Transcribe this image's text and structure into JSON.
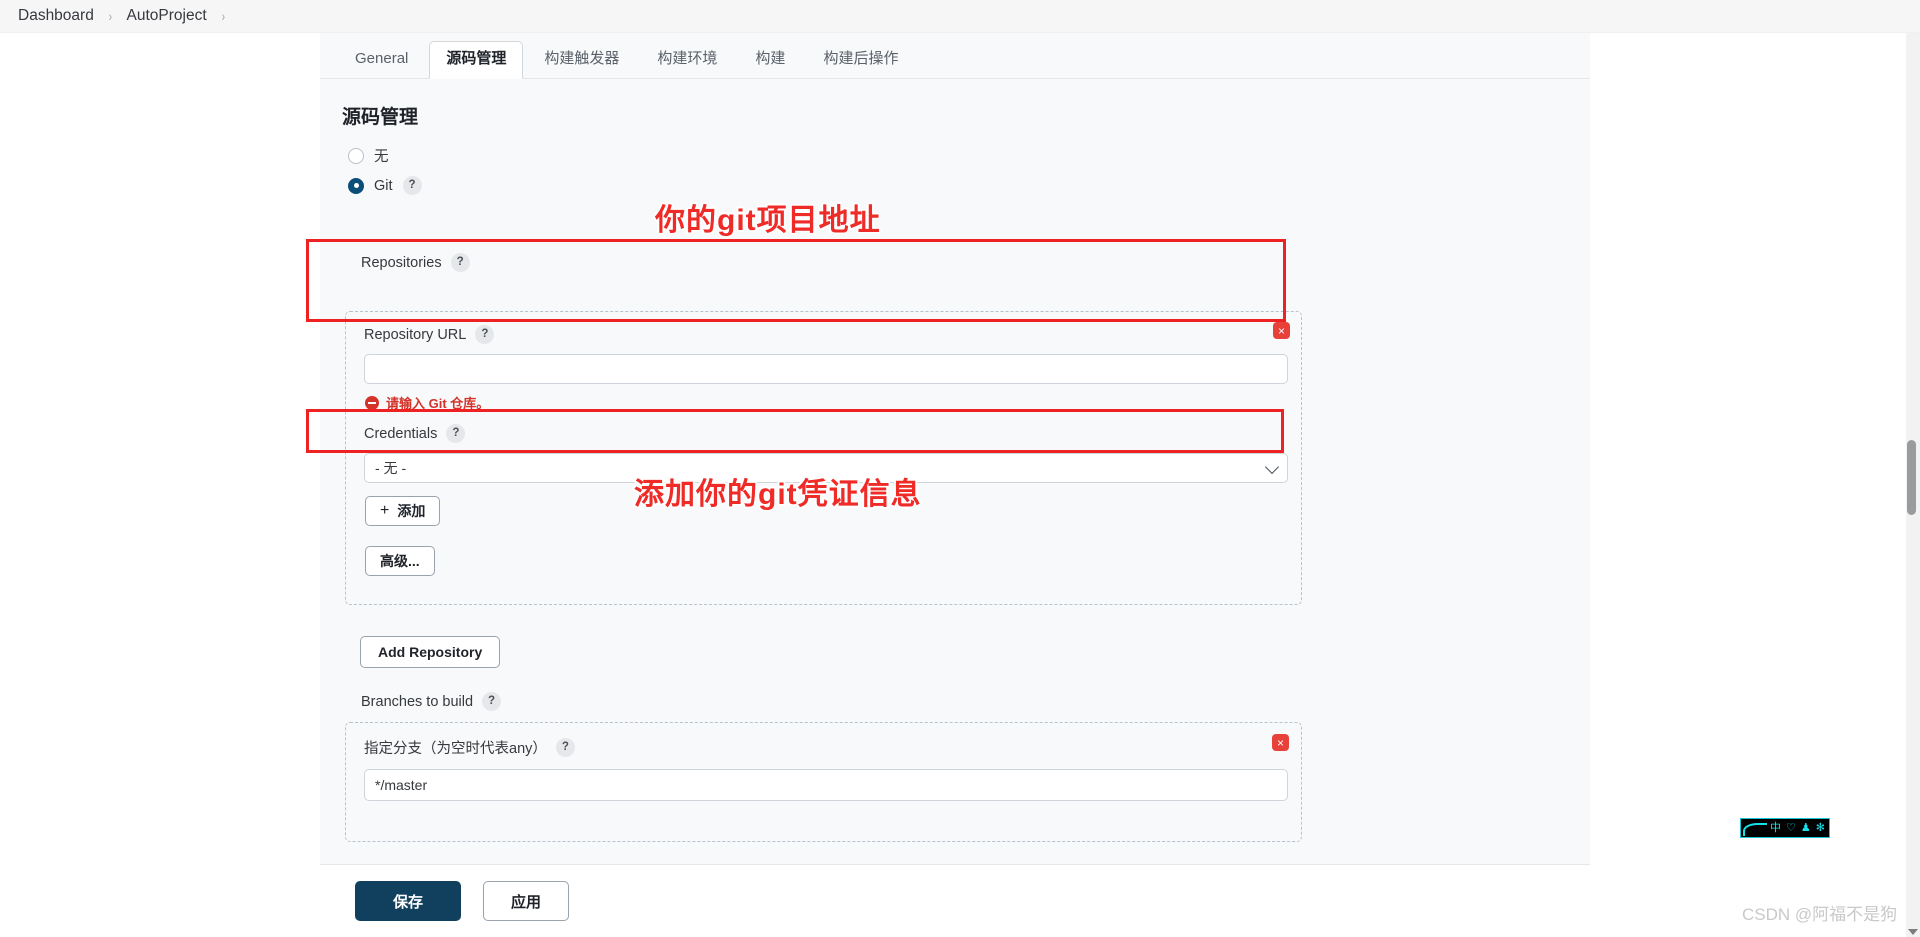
{
  "breadcrumb": {
    "items": [
      "Dashboard",
      "AutoProject"
    ],
    "separator": "›"
  },
  "tabs": [
    {
      "label": "General",
      "active": false
    },
    {
      "label": "源码管理",
      "active": true
    },
    {
      "label": "构建触发器",
      "active": false
    },
    {
      "label": "构建环境",
      "active": false
    },
    {
      "label": "构建",
      "active": false
    },
    {
      "label": "构建后操作",
      "active": false
    }
  ],
  "form": {
    "section_title": "源码管理",
    "scm_options": [
      {
        "label": "无",
        "selected": false,
        "help": false
      },
      {
        "label": "Git",
        "selected": true,
        "help": true
      }
    ],
    "repositories_label": "Repositories",
    "repository": {
      "url_label": "Repository URL",
      "url_value": "",
      "url_placeholder": "",
      "url_error": "请输入 Git 仓库。",
      "credentials_label": "Credentials",
      "credentials_value": "- 无 -",
      "credentials_options": [
        "- 无 -"
      ],
      "add_credentials_label": "添加",
      "advanced_label": "高级...",
      "remove_label": "×"
    },
    "add_repository_label": "Add Repository",
    "branches_label": "Branches to build",
    "branch": {
      "label": "指定分支（为空时代表any）",
      "value": "*/master",
      "remove_label": "×"
    },
    "help_badge": "?"
  },
  "annotations": [
    {
      "text": "你的git项目地址"
    },
    {
      "text": "添加你的git凭证信息"
    }
  ],
  "footer": {
    "save_label": "保存",
    "apply_label": "应用"
  },
  "ime": {
    "mode": "中",
    "heart": "♡",
    "person": "♟",
    "gear": "✻"
  },
  "watermark": {
    "text": "CSDN @阿福不是狗"
  },
  "colors": {
    "accent": "#11405f",
    "error": "#d4332a",
    "annotation": "#ef2b28",
    "panel_bg": "#f8f9fa"
  }
}
